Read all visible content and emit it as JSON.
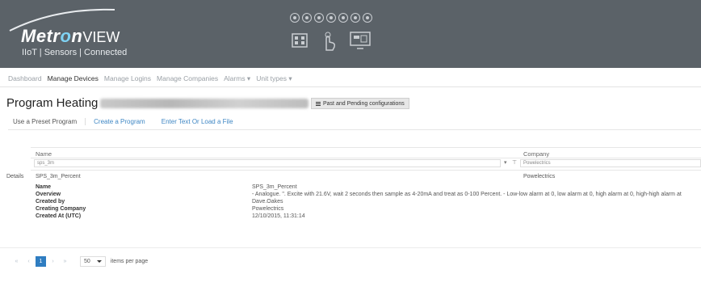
{
  "header": {
    "brand_main": "Metr",
    "brand_o": "o",
    "brand_n": "n",
    "brand_view": "VIEW",
    "tagline": "IIoT | Sensors | Connected",
    "bg_color": "#5b6268"
  },
  "nav": {
    "items": [
      "Dashboard",
      "Manage Devices",
      "Manage Logins",
      "Manage Companies",
      "Alarms ▾",
      "Unit types ▾"
    ],
    "active_index": 1
  },
  "page": {
    "title": "Program Heating",
    "config_button": "Past and Pending configurations"
  },
  "tabs": {
    "preset": "Use a Preset Program",
    "create": "Create a Program",
    "enter": "Enter Text Or Load a File"
  },
  "grid": {
    "col_name": "Name",
    "col_company": "Company",
    "filter_name_value": "sps_3m",
    "filter_company_value": "Powelectrics",
    "row": {
      "details_label": "Details",
      "name": "SPS_3m_Percent",
      "company": "Powelectrics"
    },
    "detail_labels": [
      "Name",
      "Overview",
      "Created by",
      "Creating Company",
      "Created At (UTC)"
    ],
    "detail_values": [
      "SPS_3m_Percent",
      "- Analogue. \". Excite with 21.6V, wait 2 seconds then sample as 4-20mA and treat as 0-100 Percent. - Low-low alarm at 0, low alarm at 0, high alarm at 0, high-high alarm at",
      "Dave.Oakes",
      "Powelectrics",
      "12/10/2015, 11:31:14"
    ]
  },
  "pager": {
    "first": "«",
    "prev": "‹",
    "current": "1",
    "next": "›",
    "last": "»",
    "page_size": "50",
    "per_page_label": "items per page"
  }
}
